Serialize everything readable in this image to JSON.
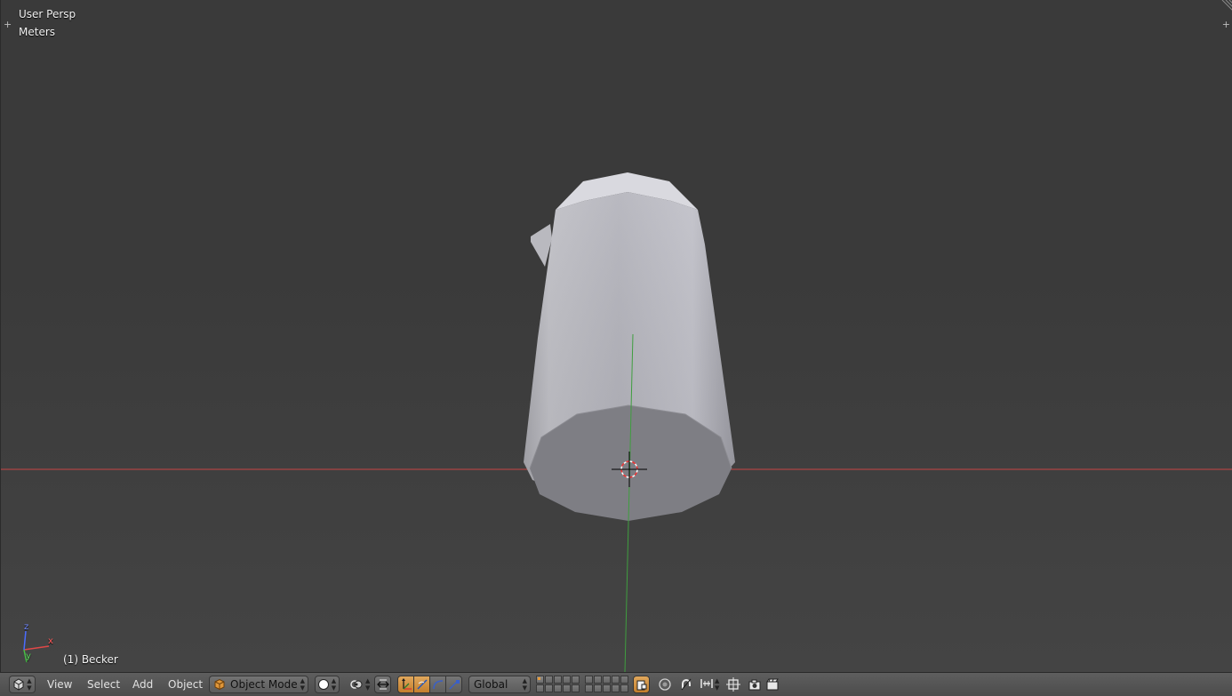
{
  "viewport": {
    "view_name": "User Persp",
    "units": "Meters",
    "active_object": "(1) Becker",
    "axis_labels": {
      "x": "x",
      "y": "y",
      "z": "z"
    }
  },
  "header": {
    "editor_type_icon": "3d-view-icon",
    "menus": [
      "View",
      "Select",
      "Add",
      "Object"
    ],
    "mode": "Object Mode",
    "shading_icon": "solid-shading-icon",
    "pivot_icon": "pivot-point-icon",
    "manipulator_icon": "manipulator-icon",
    "transform_icons": [
      "translate-icon",
      "rotate-icon",
      "scale-icon"
    ],
    "orientation": "Global",
    "lock_layers_icon": "lock-layers-icon",
    "proportional_icon": "proportional-edit-icon",
    "snap_icons": [
      "magnet-icon",
      "snap-element-icon",
      "snap-target-icon"
    ],
    "render_icons": [
      "opengl-render-icon",
      "opengl-animation-icon"
    ]
  },
  "colors": {
    "x_axis": "#c84646",
    "y_axis": "#3f9e3f",
    "accent": "#d4923c",
    "background": "#3a3a3a"
  }
}
